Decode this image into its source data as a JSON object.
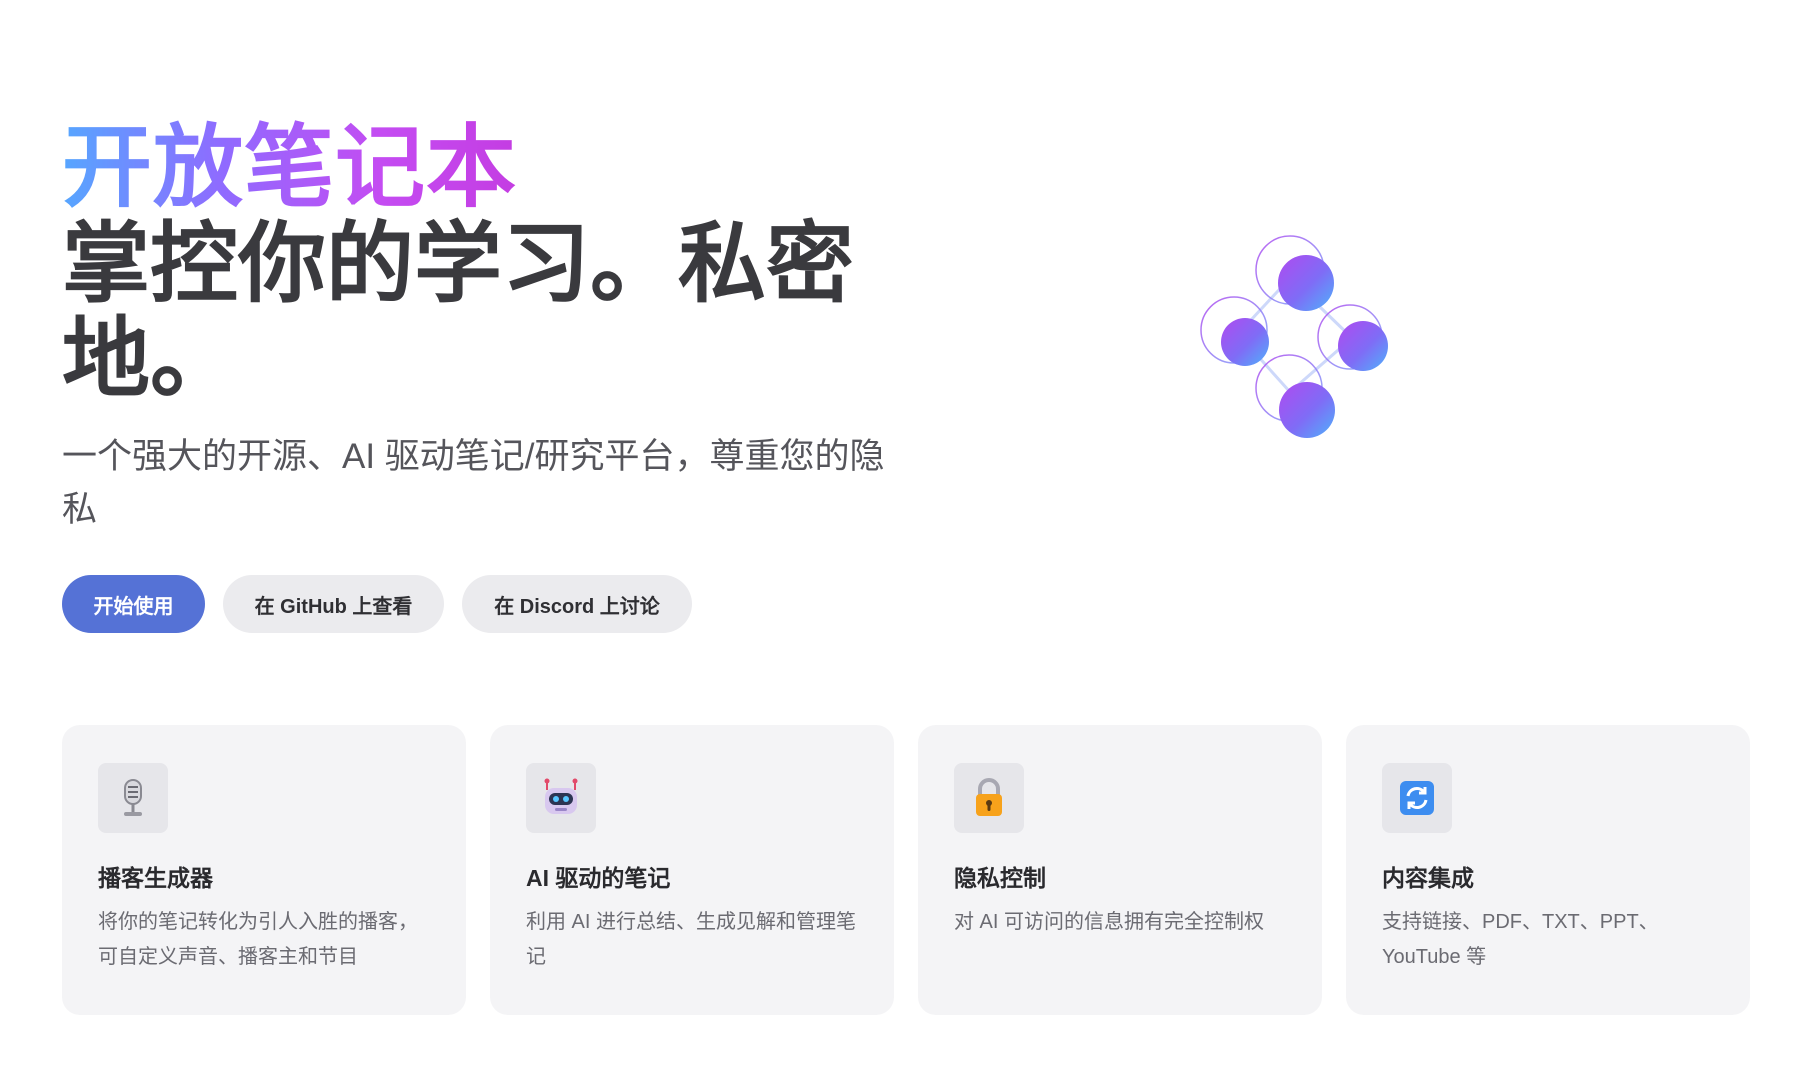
{
  "hero": {
    "brand": "开放笔记本",
    "headline": "掌控你的学习。私密地。",
    "subtitle": "一个强大的开源、AI 驱动笔记/研究平台，尊重您的隐私"
  },
  "buttons": {
    "get_started": "开始使用",
    "github": "在 GitHub 上查看",
    "discord": "在 Discord 上讨论"
  },
  "features": [
    {
      "icon": "microphone-icon",
      "title": "播客生成器",
      "description": "将你的笔记转化为引人入胜的播客，可自定义声音、播客主和节目"
    },
    {
      "icon": "robot-icon",
      "title": "AI 驱动的笔记",
      "description": "利用 AI 进行总结、生成见解和管理笔记"
    },
    {
      "icon": "lock-icon",
      "title": "隐私控制",
      "description": "对 AI 可访问的信息拥有完全控制权"
    },
    {
      "icon": "sync-icon",
      "title": "内容集成",
      "description": "支持链接、PDF、TXT、PPT、YouTube 等"
    }
  ],
  "colors": {
    "primary_button": "#5572d6",
    "brand_gradient_start": "#56a6ff",
    "brand_gradient_end": "#c43de2",
    "card_background": "#f4f4f6"
  }
}
